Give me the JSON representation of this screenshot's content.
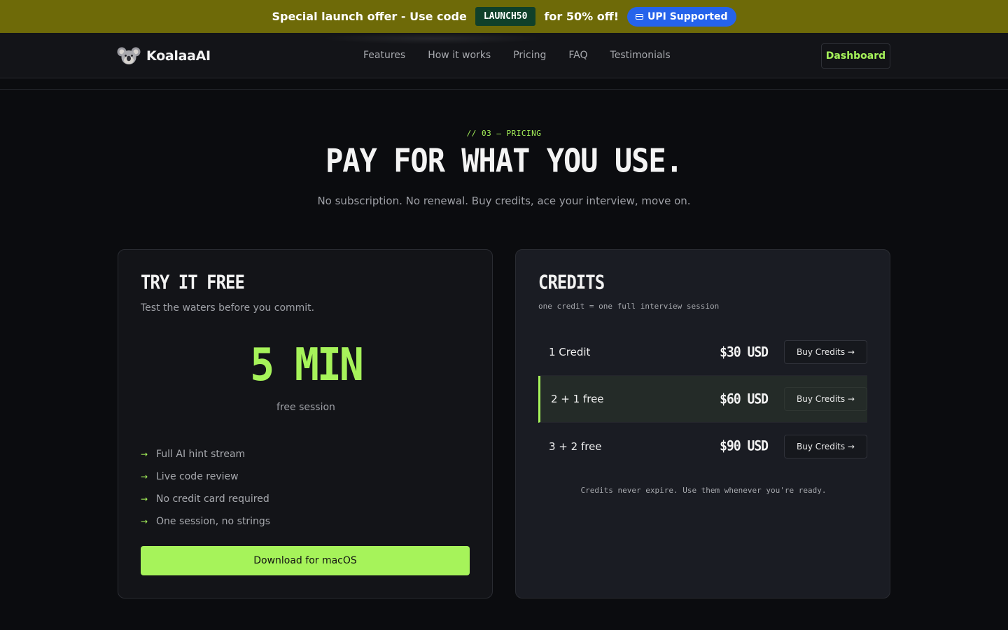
{
  "banner": {
    "text_before": "Special launch offer - Use code",
    "code": "LAUNCH50",
    "text_after": "for 50% off!",
    "upi_label": "UPI Supported",
    "upi_icon": "credit-card-icon"
  },
  "nav": {
    "brand": "KoalaaAI",
    "logo_icon": "koala-icon",
    "links": [
      "Features",
      "How it works",
      "Pricing",
      "FAQ",
      "Testimonials"
    ],
    "dashboard_label": "Dashboard"
  },
  "section": {
    "eyebrow": "// 03 — PRICING",
    "title": "PAY FOR WHAT YOU USE.",
    "subtitle": "No subscription. No renewal. Buy credits, ace your interview, move on."
  },
  "free_card": {
    "title": "TRY IT FREE",
    "description": "Test the waters before you commit.",
    "amount": "5 MIN",
    "amount_caption": "free session",
    "features": [
      "Full AI hint stream",
      "Live code review",
      "No credit card required",
      "One session, no strings"
    ],
    "feature_arrow": "→",
    "cta": "Download for macOS"
  },
  "credits_card": {
    "title": "CREDITS",
    "note": "one credit = one full interview session",
    "tiers": [
      {
        "qty": "1 Credit",
        "price": "$30 USD",
        "cta": "Buy Credits →"
      },
      {
        "qty": "2 + 1 free",
        "price": "$60 USD",
        "cta": "Buy Credits →"
      },
      {
        "qty": "3 + 2 free",
        "price": "$90 USD",
        "cta": "Buy Credits →"
      }
    ],
    "highlighted_tier": 1,
    "footer": "Credits never expire. Use them whenever you're ready."
  },
  "colors": {
    "accent": "#a6f35a",
    "banner_bg": "#6e6a08",
    "upi_bg": "#2563eb",
    "page_bg": "#0b0c0f"
  }
}
